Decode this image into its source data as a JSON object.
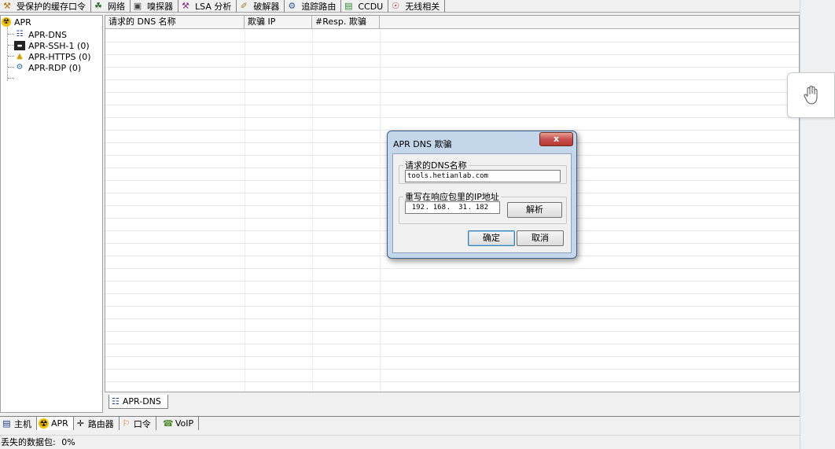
{
  "top_tabs": [
    {
      "icon": "key-icon",
      "label": "受保护的缓存口令"
    },
    {
      "icon": "network-icon",
      "label": "网络"
    },
    {
      "icon": "sniffer-icon",
      "label": "嗅探器"
    },
    {
      "icon": "lsa-icon",
      "label": "LSA 分析"
    },
    {
      "icon": "cracker-icon",
      "label": "破解器"
    },
    {
      "icon": "traceroute-icon",
      "label": "追踪路由"
    },
    {
      "icon": "ccdu-icon",
      "label": "CCDU"
    },
    {
      "icon": "wireless-icon",
      "label": "无线相关"
    }
  ],
  "tree": {
    "root": "APR",
    "children": [
      "APR-DNS",
      "APR-SSH-1 (0)",
      "APR-HTTPS (0)",
      "APR-RDP (0)"
    ]
  },
  "table": {
    "columns": [
      "请求的 DNS 名称",
      "欺骗 IP",
      "#Resp. 欺骗"
    ]
  },
  "sub_tab": "APR-DNS",
  "bottom_tabs": [
    {
      "icon": "host-icon",
      "label": "主机"
    },
    {
      "icon": "apr-icon",
      "label": "APR"
    },
    {
      "icon": "router-icon",
      "label": "路由器"
    },
    {
      "icon": "password-icon",
      "label": "口令"
    },
    {
      "icon": "voip-icon",
      "label": "VoIP"
    }
  ],
  "status": {
    "label": "丢失的数据包:",
    "value": "0%"
  },
  "dialog": {
    "title": "APR DNS 欺骗",
    "close": "x",
    "group1_legend": "请求的DNS名称",
    "dns_name": "tools.hetianlab.com",
    "group2_legend": "重写在响应包里的IP地址",
    "ip": [
      "192",
      "168",
      "31",
      "182"
    ],
    "resolve_button": "解析",
    "ok_button": "确定",
    "cancel_button": "取消"
  },
  "colors": {
    "dialog_frame": "#c4d7ea",
    "close_button": "#c75050"
  }
}
